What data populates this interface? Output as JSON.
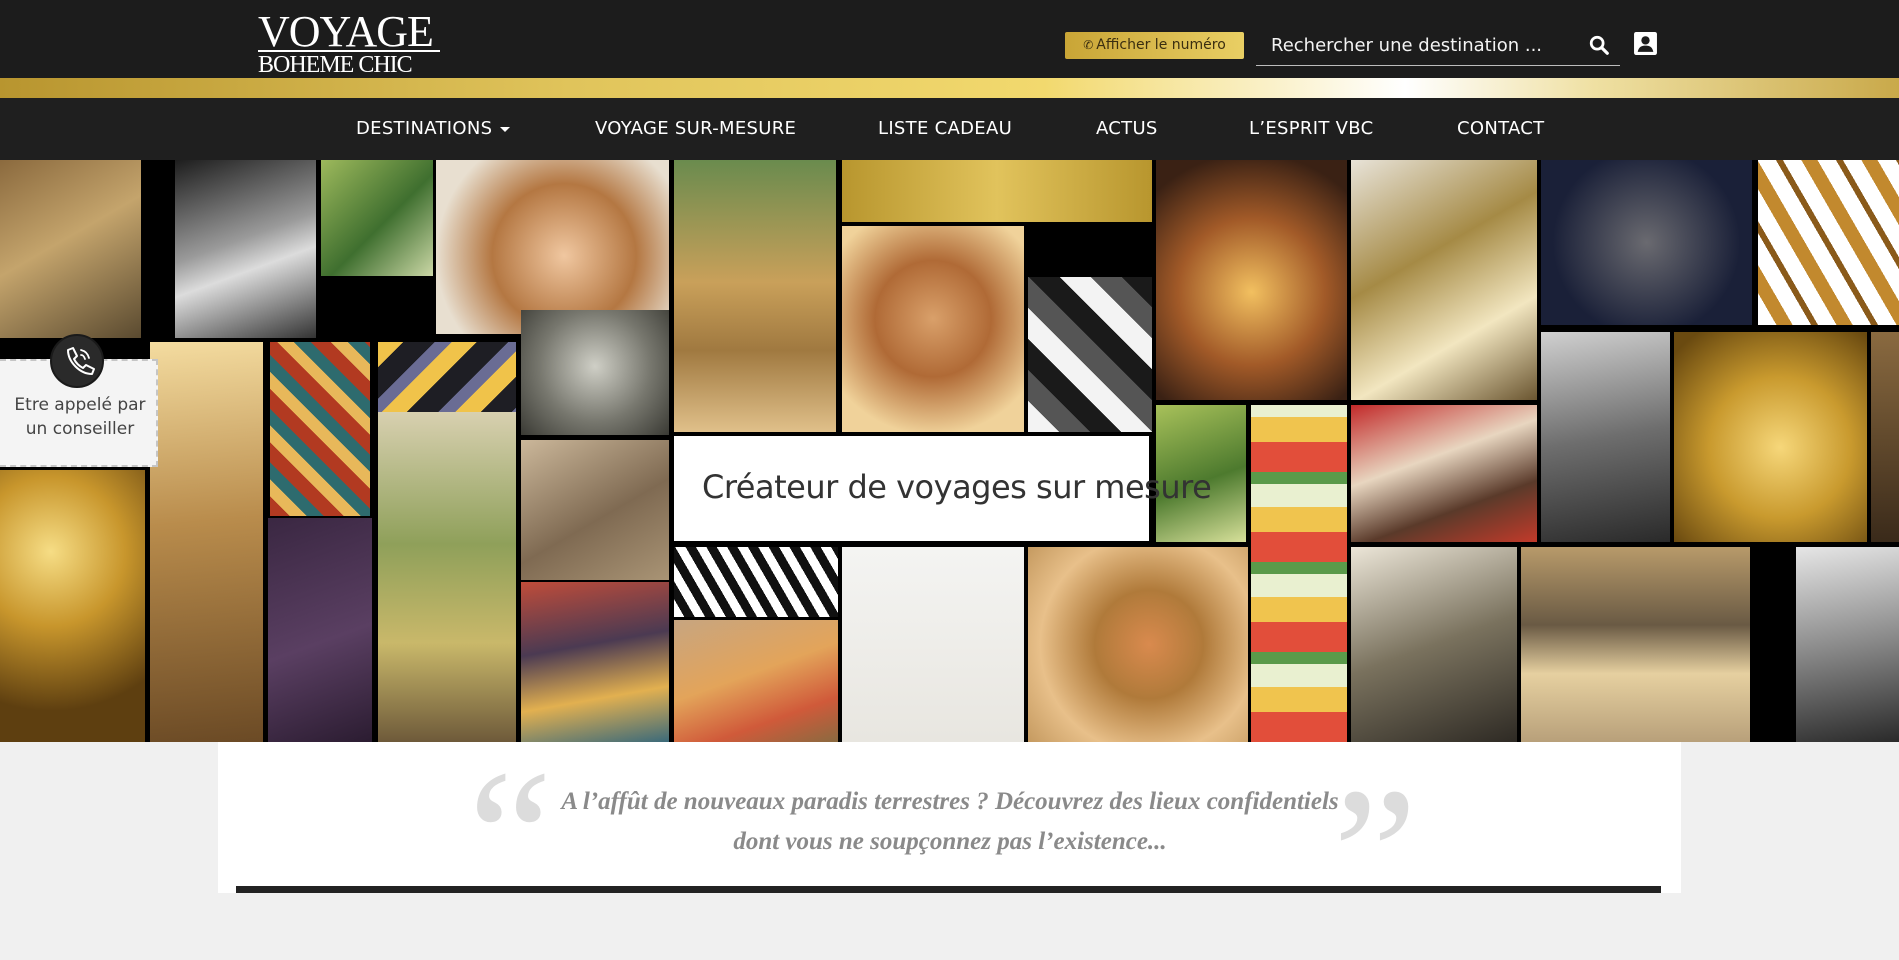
{
  "header": {
    "logo_line1": "VOYAGE",
    "logo_line2": "BOHEME CHIC",
    "phone_button": "Afficher le numéro",
    "search_placeholder": "Rechercher une destination ...",
    "search_icon": "search-icon",
    "account_icon": "user-account-icon"
  },
  "nav": {
    "items": [
      {
        "label": "DESTINATIONS"
      },
      {
        "label": "VOYAGE SUR-MESURE"
      },
      {
        "label": "LISTE CADEAU"
      },
      {
        "label": "ACTUS"
      },
      {
        "label": "L’ESPRIT VBC"
      },
      {
        "label": "CONTACT"
      }
    ]
  },
  "hero": {
    "headline": "Créateur de voyages sur mesure"
  },
  "callback": {
    "icon": "phone-icon",
    "text_line1": "Etre appelé par",
    "text_line2": "un conseiller"
  },
  "intro": {
    "line1": "A l’affût de nouveaux paradis terrestres ? Découvrez des lieux confidentiels",
    "line2": "dont vous ne soupçonnez pas l’existence..."
  },
  "colors": {
    "header_bg": "#1c1c1c",
    "gold": "#e0c45b",
    "nav_bg": "#1f1f1f",
    "quote_text": "#8a8a8a"
  }
}
